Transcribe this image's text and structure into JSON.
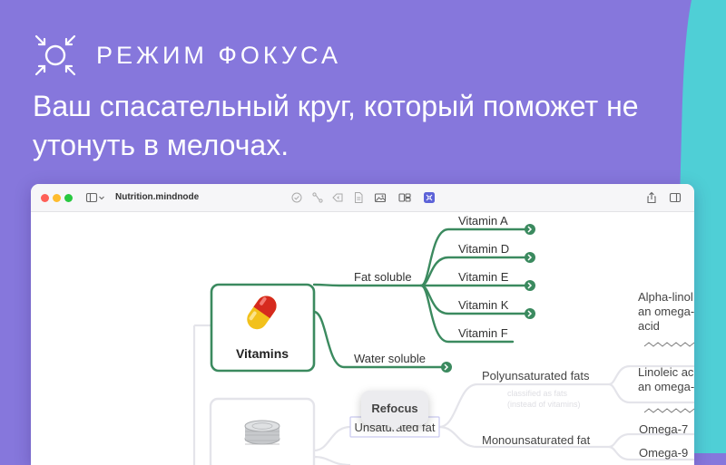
{
  "header": {
    "focus_label": "РЕЖИМ ФОКУСА",
    "headline": "Ваш спасательный круг, который поможет не утонуть в мелочах."
  },
  "window": {
    "doc_title": "Nutrition.mindnode",
    "toolbar_icons": [
      "sidebar-icon",
      "chevron-down-icon",
      "check-icon",
      "connect-icon",
      "tag-icon",
      "note-icon",
      "image-icon",
      "outline-icon",
      "focus-icon",
      "share-icon",
      "inspector-icon"
    ]
  },
  "mindmap": {
    "vitamins": "Vitamins",
    "fat_soluble": "Fat soluble",
    "water_soluble": "Water soluble",
    "vitamin_a": "Vitamin A",
    "vitamin_d": "Vitamin D",
    "vitamin_e": "Vitamin E",
    "vitamin_k": "Vitamin K",
    "vitamin_f": "Vitamin F",
    "alpha_l1": "Alpha-linol",
    "alpha_l2": "an omega-",
    "alpha_l3": "acid",
    "linoleic_l1": "Linoleic ac",
    "linoleic_l2": "an omega-",
    "unsaturated": "Unsaturated fat",
    "polyunsaturated": "Polyunsaturated fats",
    "monounsaturated": "Monounsaturated fat",
    "omega7": "Omega-7",
    "omega9": "Omega-9",
    "faded_note_1": "classified as fats",
    "faded_note_2": "(instead of vitamins)",
    "refocus": "Refocus"
  },
  "colors": {
    "background": "#8677dc",
    "teal": "#4fcfd6",
    "branch_green": "#3b8a5f"
  }
}
